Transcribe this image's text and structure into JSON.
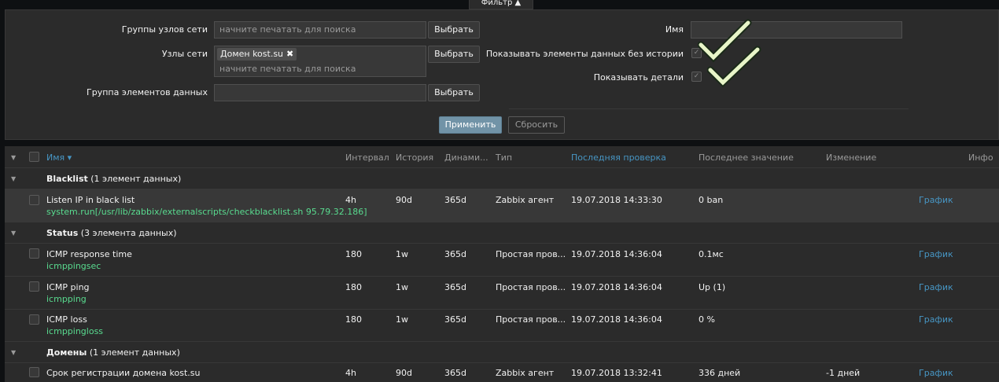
{
  "filter": {
    "tab_label": "Фильтр ▲",
    "host_groups_label": "Группы узлов сети",
    "host_groups_placeholder": "начните печатать для поиска",
    "hosts_label": "Узлы сети",
    "hosts_chip": "Домен kost.su",
    "hosts_placeholder": "начните печатать для поиска",
    "app_label": "Группа элементов данных",
    "select_label": "Выбрать",
    "name_label": "Имя",
    "name_value": "",
    "show_without_history_label": "Показывать элементы данных без истории",
    "show_details_label": "Показывать детали",
    "apply_label": "Применить",
    "reset_label": "Сбросить"
  },
  "table": {
    "headers": {
      "name": "Имя ▾",
      "interval": "Интервал",
      "history": "История",
      "trends": "Динами...",
      "type": "Тип",
      "last_check": "Последняя проверка",
      "last_value": "Последнее значение",
      "change": "Изменение",
      "info": "Инфо"
    },
    "groups": [
      {
        "name": "Blacklist",
        "count": "(1 элемент данных)",
        "items": [
          {
            "name": "Listen IP in black list",
            "key": "system.run[/usr/lib/zabbix/externalscripts/checkblacklist.sh 95.79.32.186]",
            "interval": "4h",
            "history": "90d",
            "trends": "365d",
            "type": "Zabbix агент",
            "last_check": "19.07.2018 14:33:30",
            "last_value": "0 ban",
            "change": "",
            "graph": "График"
          }
        ]
      },
      {
        "name": "Status",
        "count": "(3 элемента данных)",
        "items": [
          {
            "name": "ICMP response time",
            "key": "icmppingsec",
            "interval": "180",
            "history": "1w",
            "trends": "365d",
            "type": "Простая пров...",
            "last_check": "19.07.2018 14:36:04",
            "last_value": "0.1мс",
            "change": "",
            "graph": "График"
          },
          {
            "name": "ICMP ping",
            "key": "icmpping",
            "interval": "180",
            "history": "1w",
            "trends": "365d",
            "type": "Простая пров...",
            "last_check": "19.07.2018 14:36:04",
            "last_value": "Up (1)",
            "change": "",
            "graph": "График"
          },
          {
            "name": "ICMP loss",
            "key": "icmppingloss",
            "interval": "180",
            "history": "1w",
            "trends": "365d",
            "type": "Простая пров...",
            "last_check": "19.07.2018 14:36:04",
            "last_value": "0 %",
            "change": "",
            "graph": "График"
          }
        ]
      },
      {
        "name": "Домены",
        "count": "(1 элемент данных)",
        "items": [
          {
            "name": "Срок регистрации домена kost.su",
            "key": "",
            "interval": "4h",
            "history": "90d",
            "trends": "365d",
            "type": "Zabbix агент",
            "last_check": "19.07.2018 13:32:41",
            "last_value": "336 дней",
            "change": "-1 дней",
            "graph": "График"
          }
        ]
      }
    ]
  },
  "colors": {
    "background": "#2b2b2b",
    "link": "#4796c4",
    "key_green": "#59db8f",
    "apply_button": "#7193a7"
  }
}
